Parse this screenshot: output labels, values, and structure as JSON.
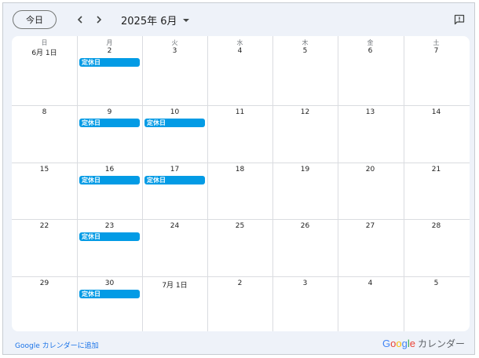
{
  "toolbar": {
    "today_label": "今日",
    "month_title": "2025年 6月"
  },
  "weekdays": [
    "日",
    "月",
    "火",
    "水",
    "木",
    "金",
    "土"
  ],
  "weeks": [
    [
      "6月 1日",
      "2",
      "3",
      "4",
      "5",
      "6",
      "7"
    ],
    [
      "8",
      "9",
      "10",
      "11",
      "12",
      "13",
      "14"
    ],
    [
      "15",
      "16",
      "17",
      "18",
      "19",
      "20",
      "21"
    ],
    [
      "22",
      "23",
      "24",
      "25",
      "26",
      "27",
      "28"
    ],
    [
      "29",
      "30",
      "7月 1日",
      "2",
      "3",
      "4",
      "5"
    ]
  ],
  "events": [
    {
      "week": 0,
      "day": 1,
      "label": "定休日"
    },
    {
      "week": 1,
      "day": 1,
      "label": "定休日"
    },
    {
      "week": 1,
      "day": 2,
      "label": "定休日"
    },
    {
      "week": 2,
      "day": 1,
      "label": "定休日"
    },
    {
      "week": 2,
      "day": 2,
      "label": "定休日"
    },
    {
      "week": 3,
      "day": 1,
      "label": "定休日"
    },
    {
      "week": 4,
      "day": 1,
      "label": "定休日"
    }
  ],
  "colors": {
    "event": "#039be5",
    "link": "#1a73e8"
  },
  "footer": {
    "add_link": "Google カレンダーに追加",
    "brand_letters": [
      "G",
      "o",
      "o",
      "g",
      "l",
      "e"
    ],
    "brand_colors": [
      "#4285f4",
      "#ea4335",
      "#fbbc05",
      "#4285f4",
      "#34a853",
      "#ea4335"
    ],
    "brand_suffix": "カレンダー"
  }
}
